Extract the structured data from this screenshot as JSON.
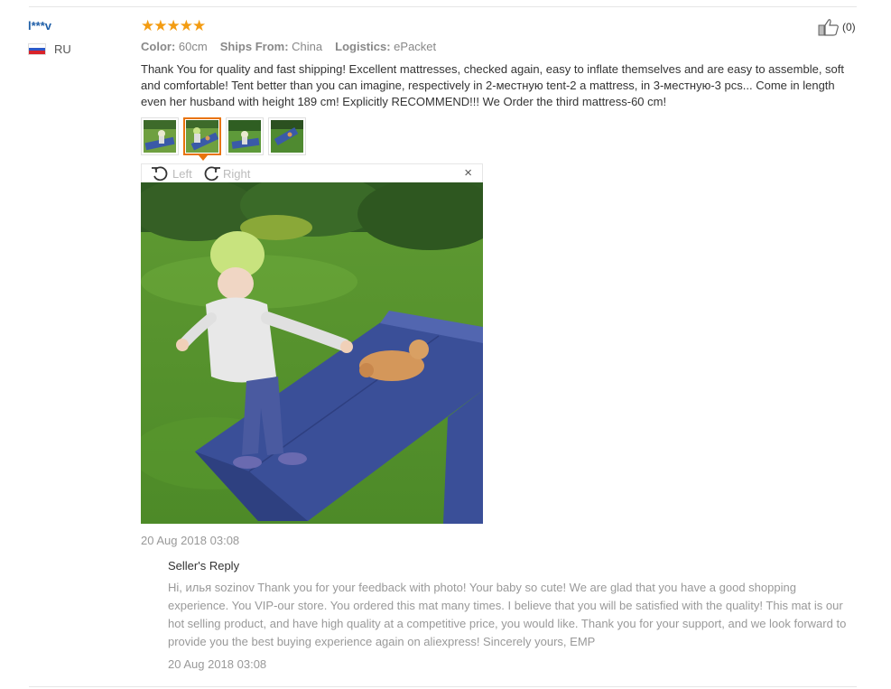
{
  "review": {
    "user_name": "l***v",
    "country": "RU",
    "rating_stars": "★★★★★",
    "attributes": [
      {
        "label": "Color:",
        "value": "60cm"
      },
      {
        "label": "Ships From:",
        "value": "China"
      },
      {
        "label": "Logistics:",
        "value": "ePacket"
      }
    ],
    "helpful_count": "(0)",
    "text": "Thank You for quality and fast shipping! Excellent mattresses, checked again, easy to inflate themselves and are easy to assemble, soft and comfortable! Tent better than you can imagine, respectively in 2-местную tent-2 a mattress, in 3-местную-3 pcs... Come in length even her husband with height 189 cm! Explicitly RECOMMEND!!! We Order the third mattress-60 cm!",
    "date": "20 Aug 2018 03:08"
  },
  "viewer": {
    "rotate_left": "Left",
    "rotate_right": "Right",
    "close": "×"
  },
  "seller_reply": {
    "title": "Seller's Reply",
    "text": "Hi, илья sozinov Thank you for your feedback with photo! Your baby so cute! We are glad that you have a good shopping experience. You VIP-our store. You ordered this mat many times. I believe that you will be satisfied with the quality! This mat is our hot selling product, and have high quality at a competitive price, you would like. Thank you for your support, and we look forward to provide you the best buying experience again on aliexpress! Sincerely yours, EMP",
    "date": "20 Aug 2018 03:08"
  },
  "colors": {
    "star": "#f39c12",
    "username": "#1f5fa8",
    "active_thumb": "#e8740c"
  }
}
